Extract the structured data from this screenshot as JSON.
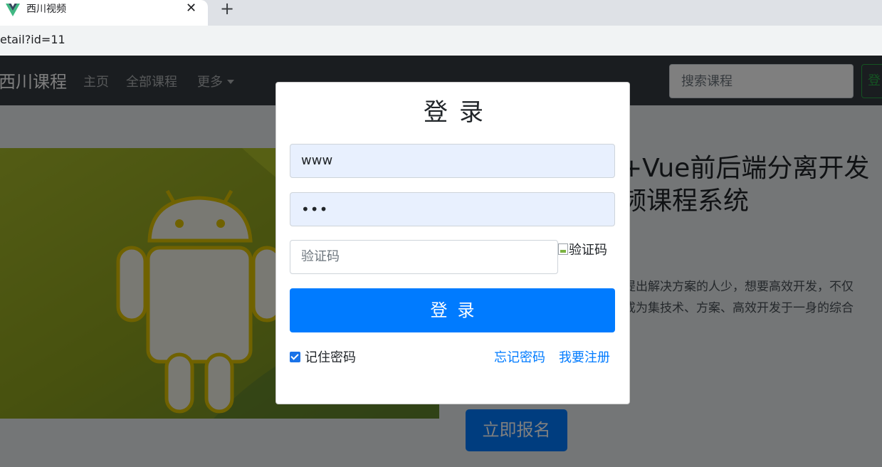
{
  "browser": {
    "tab_title": "西川视频",
    "tab_close": "✕",
    "new_tab": "+",
    "url": "etail?id=11"
  },
  "navbar": {
    "brand": "西川课程",
    "links": [
      "主页",
      "全部课程",
      "更多"
    ],
    "search_placeholder": "搜索课程",
    "login_button": "登"
  },
  "course": {
    "title_line1": "+Vue前后端分离开发",
    "title_line2": "频课程系统",
    "desc_line1": "提出解决方案的人少，想要高效开发，不仅",
    "desc_line2": "成为集技术、方案、高效开发于一身的综合",
    "enroll_button": "立即报名"
  },
  "login_modal": {
    "title": "登录",
    "username_value": "www",
    "password_mask": "•••",
    "captcha_placeholder": "验证码",
    "captcha_image_alt": "验证码",
    "submit_button": "登录",
    "remember_label": "记住密码",
    "remember_checked": true,
    "forgot_link": "忘记密码",
    "register_link": "我要注册"
  },
  "colors": {
    "primary": "#007bff",
    "navbar_bg": "#343a40",
    "success": "#28a745",
    "autofill_bg": "#e8f0fe"
  }
}
